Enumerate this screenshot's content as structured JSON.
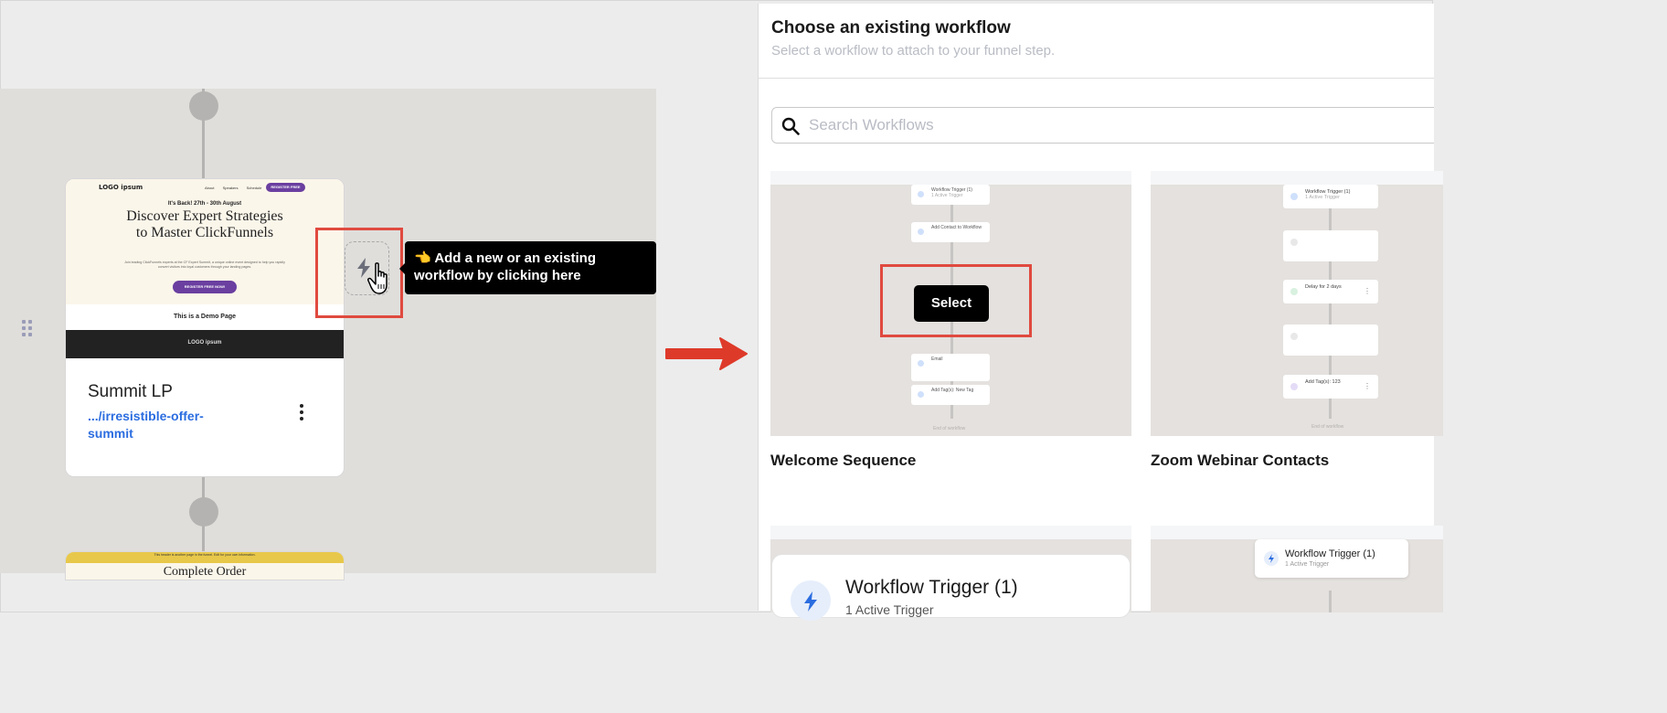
{
  "funnel_canvas": {
    "preview": {
      "logo": "LOGO ipsum",
      "nav": [
        "About",
        "Speakers",
        "Schedule"
      ],
      "nav_button": "REGISTER FREE",
      "eyebrow": "It's Back! 27th - 30th August",
      "headline": "Discover Expert Strategies to Master ClickFunnels",
      "body": "Join leading ClickFunnels experts at the CF Expert Summit, a unique online event designed to help you rapidly convert visitors into loyal customers through your landing pages.",
      "cta": "REGISTER FREE NOW!",
      "demo_label": "This is a Demo Page",
      "footer_logo": "LOGO ipsum"
    },
    "step": {
      "title": "Summit LP",
      "url": ".../irresistible-offer-summit"
    },
    "next_step": {
      "banner": "This header is another page in the funnel. Edit for your own information.",
      "title_fragment": "Complete Order"
    },
    "tooltip": {
      "emoji": "👈",
      "text": "Add a new or an existing workflow by clicking here"
    }
  },
  "chooser": {
    "title": "Choose an existing workflow",
    "subtitle": "Select a workflow to attach to your funnel step.",
    "search": {
      "placeholder": "Search Workflows",
      "value": ""
    },
    "select_label": "Select",
    "workflows": [
      {
        "name": "Welcome Sequence",
        "steps": [
          "Workflow Trigger (1)",
          "Add Contact to Workflow",
          "",
          "Email",
          "Add Tag(s): New Tag"
        ],
        "step_sub": "1 Active Trigger",
        "end_label": "End of workflow"
      },
      {
        "name": "Zoom Webinar Contacts",
        "steps": [
          "Workflow Trigger (1)",
          "",
          "Delay for 2 days",
          "",
          "Add Tag(s): 123"
        ],
        "step_sub": "1 Active Trigger",
        "end_label": "End of workflow"
      },
      {
        "trigger_title": "Workflow Trigger (1)",
        "trigger_sub": "1 Active Trigger"
      },
      {
        "trigger_title": "Workflow Trigger (1)",
        "trigger_sub": "1 Active Trigger"
      }
    ]
  },
  "colors": {
    "highlight": "#e04a3f",
    "link": "#2b6de0",
    "brand_purple": "#6a3fa0"
  },
  "icons": [
    "drag-handle-icon",
    "bolt-icon",
    "pointer-hand-icon",
    "right-arrow-icon",
    "search-icon",
    "kebab-menu-icon"
  ]
}
